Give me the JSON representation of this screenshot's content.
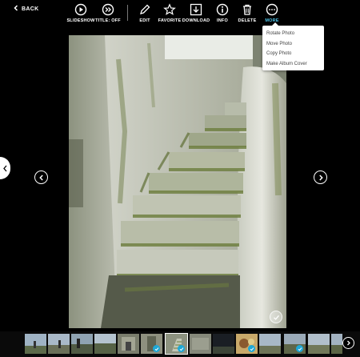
{
  "toolbar": {
    "back_label": "BACK",
    "items": [
      {
        "label": "SLIDESHOW",
        "icon": "play-circle-icon"
      },
      {
        "label": "TITLE: OFF",
        "icon": "title-toggle-icon"
      },
      {
        "label": "EDIT",
        "icon": "pencil-icon"
      },
      {
        "label": "FAVORITE",
        "icon": "star-icon"
      },
      {
        "label": "DOWNLOAD",
        "icon": "download-icon"
      },
      {
        "label": "INFO",
        "icon": "info-icon"
      },
      {
        "label": "DELETE",
        "icon": "trash-icon"
      },
      {
        "label": "MORE",
        "icon": "more-dots-icon"
      }
    ],
    "active_item": "MORE",
    "active_color": "#4fc3e8"
  },
  "more_menu": {
    "items": [
      "Rotate Photo",
      "Move Photo",
      "Copy Photo",
      "Make Album Cover"
    ]
  },
  "photo": {
    "subject": "spiral-stone-staircase",
    "selected": true
  },
  "filmstrip": {
    "thumbnails": [
      {
        "selected": false,
        "checked": false
      },
      {
        "selected": false,
        "checked": false
      },
      {
        "selected": false,
        "checked": false
      },
      {
        "selected": false,
        "checked": false
      },
      {
        "selected": false,
        "checked": false
      },
      {
        "selected": false,
        "checked": true
      },
      {
        "selected": true,
        "checked": true
      },
      {
        "selected": false,
        "checked": false
      },
      {
        "selected": false,
        "checked": false
      },
      {
        "selected": false,
        "checked": true
      },
      {
        "selected": false,
        "checked": false
      },
      {
        "selected": false,
        "checked": true
      },
      {
        "selected": false,
        "checked": false
      },
      {
        "selected": false,
        "checked": true
      }
    ],
    "check_color": "#1fa8d6"
  }
}
